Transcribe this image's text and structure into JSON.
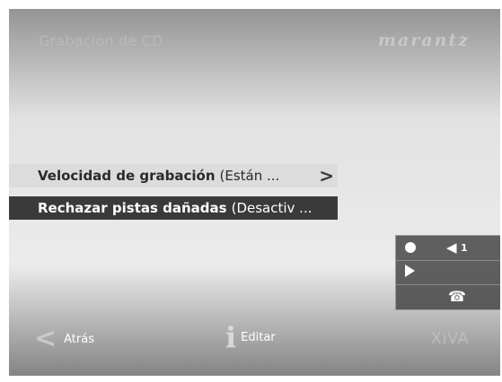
{
  "header": {
    "title": "Grabación de CD",
    "brand": "marantz"
  },
  "menu": {
    "items": [
      {
        "label": "Velocidad de grabación",
        "value": "(Están ...",
        "selected": true
      },
      {
        "label": "Rechazar pistas dañadas",
        "value": "(Desactiv ...",
        "selected": false
      }
    ]
  },
  "status_panel": {
    "volume_level": "1",
    "icons": [
      "record-icon",
      "volume-icon",
      "play-icon",
      "phone-icon"
    ]
  },
  "footer": {
    "back_label": "Atrás",
    "edit_label": "Editar",
    "logo": "XiVA"
  },
  "colors": {
    "selected_row": "#dcdcdc",
    "row_bg": "#3a3a3a",
    "background": "#585858"
  }
}
